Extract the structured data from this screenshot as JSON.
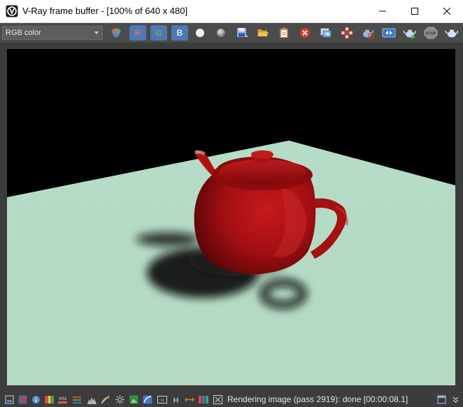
{
  "window": {
    "title": "V-Ray frame buffer - [100% of 640 x 480]"
  },
  "toolbar": {
    "channel_select": {
      "value": "RGB color"
    },
    "channel_buttons": {
      "r": "R",
      "g": "G",
      "b": "B"
    },
    "icons": [
      "rgb-channels-icon",
      "white-point-icon",
      "grey-sphere-icon",
      "save-image-icon",
      "open-image-icon",
      "clipboard-icon",
      "clear-image-icon",
      "duplicate-to-history-icon",
      "track-mouse-icon",
      "render-region-icon",
      "link-vfb-icon",
      "render-teapot-icon",
      "interactive-render-icon",
      "stop-render-icon",
      "render-icon"
    ]
  },
  "status": {
    "text": "Rendering image (pass 2919): done [00:00:08.1]"
  },
  "statusbar": {
    "icons": [
      "color-correction-icon",
      "exposure-icon",
      "info-icon",
      "levels-icon",
      "hsl-icon",
      "curves-icon",
      "histogram-icon",
      "lut-icon",
      "white-balance-icon",
      "color-balance-icon",
      "background-image-icon",
      "lens-effects-icon",
      "ocio-icon",
      "horizontal-icon",
      "compare-icon",
      "pixel-info-icon"
    ]
  },
  "colors": {
    "toolbar_bg": "#4b4b4b",
    "status_bg": "#3c3c3c",
    "channel_button": "#4e78b4",
    "floor": "#b8dcc6",
    "teapot": "#a40f10"
  }
}
